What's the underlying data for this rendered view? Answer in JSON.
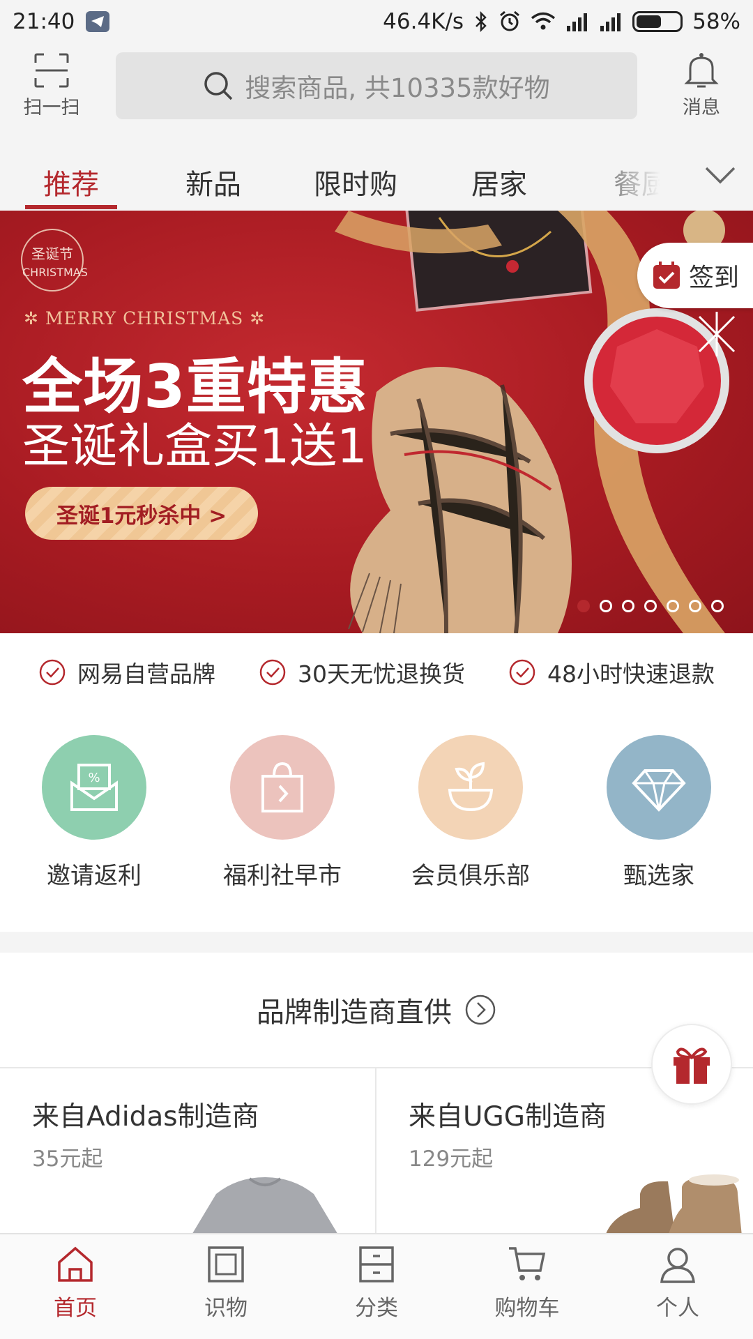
{
  "status_bar": {
    "time": "21:40",
    "network_speed": "46.4K/s",
    "battery": "58%",
    "battery_level": 0.58,
    "icons": [
      "telegram-icon",
      "bluetooth-icon",
      "alarm-icon",
      "wifi-icon",
      "signal-icon",
      "signal-icon",
      "battery-icon"
    ]
  },
  "header": {
    "scan_label": "扫一扫",
    "search_placeholder": "搜索商品, 共10335款好物",
    "messages_label": "消息"
  },
  "tabs": [
    {
      "label": "推荐",
      "active": true
    },
    {
      "label": "新品"
    },
    {
      "label": "限时购"
    },
    {
      "label": "居家"
    },
    {
      "label": "餐厨"
    }
  ],
  "banner": {
    "badge_cn": "圣诞节",
    "badge_en": "CHRISTMAS",
    "eyebrow": "MERRY CHRISTMAS",
    "headline": "全场3重特惠",
    "subheadline": "圣诞礼盒买1送1",
    "cta": "圣诞1元秒杀中 >",
    "slide_count": 7,
    "active_slide": 1,
    "sign_in_label": "签到"
  },
  "promises": [
    "网易自营品牌",
    "30天无忧退换货",
    "48小时快速退款"
  ],
  "shortcuts": [
    {
      "label": "邀请返利",
      "icon": "envelope-icon",
      "color": "#8ecfaf"
    },
    {
      "label": "福利社早市",
      "icon": "shopping-bag-icon",
      "color": "#ecc3bd"
    },
    {
      "label": "会员俱乐部",
      "icon": "sprout-icon",
      "color": "#f3d4b6"
    },
    {
      "label": "甄选家",
      "icon": "diamond-icon",
      "color": "#93b5c8"
    }
  ],
  "brand_section": {
    "title": "品牌制造商直供",
    "cards": [
      {
        "title": "来自Adidas制造商",
        "price": "35元起"
      },
      {
        "title": "来自UGG制造商",
        "price": "129元起"
      }
    ]
  },
  "bottom_nav": [
    {
      "label": "首页",
      "icon": "home-icon",
      "active": true
    },
    {
      "label": "识物",
      "icon": "square-frame-icon"
    },
    {
      "label": "分类",
      "icon": "category-drawer-icon"
    },
    {
      "label": "购物车",
      "icon": "cart-icon"
    },
    {
      "label": "个人",
      "icon": "person-icon"
    }
  ],
  "colors": {
    "brand_red": "#b4282d",
    "background_gray": "#f4f4f4"
  }
}
